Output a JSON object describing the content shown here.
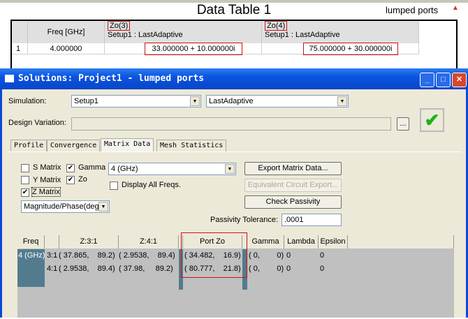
{
  "report": {
    "title": "Data Table 1",
    "subtitle": "lumped ports",
    "headers": [
      "Freq [GHz]",
      "Zo(3)",
      "Zo(4)"
    ],
    "sub_header": "Setup1 : LastAdaptive",
    "rows": [
      {
        "index": "1",
        "freq": "4.000000",
        "zo3": "33.000000 + 10.000000i",
        "zo4": "75.000000 + 30.000000i"
      }
    ]
  },
  "dialog": {
    "title": "Solutions: Project1 - lumped ports",
    "simulation_label": "Simulation:",
    "setup": "Setup1",
    "pass": "LastAdaptive",
    "design_variation_label": "Design Variation:",
    "design_variation": "",
    "browse": "...",
    "tabs": [
      "Profile",
      "Convergence",
      "Matrix Data",
      "Mesh Statistics"
    ],
    "active_tab": "Matrix Data",
    "checkboxes": {
      "s_matrix": "S Matrix",
      "gamma": "Gamma",
      "y_matrix": "Y Matrix",
      "zo": "Zo",
      "z_matrix": "Z Matrix",
      "display_all": "Display All Freqs."
    },
    "format": "Magnitude/Phase(deg",
    "freq": "4 (GHz)",
    "buttons": {
      "export": "Export Matrix Data...",
      "equiv": "Equivalent Circuit Export...",
      "passivity": "Check Passivity"
    },
    "tolerance_label": "Passivity Tolerance:",
    "tolerance": ".0001",
    "grid": {
      "headers": [
        "Freq",
        "",
        "Z:3:1",
        "Z:4:1",
        "Port Zo",
        "Gamma",
        "Lambda",
        "Epsilon"
      ],
      "freq": "4 (GHz)",
      "rows": [
        {
          "label": "3:1",
          "z31": "( 37.865,    89.2)",
          "z41": "( 2.9538,    89.4)",
          "portzo": "( 34.482,    16.9)",
          "gamma": "( 0,        0)",
          "lambda": "0",
          "epsilon": "0"
        },
        {
          "label": "4:1",
          "z31": "( 2.9538,    89.4)",
          "z41": "( 37.98,     89.2)",
          "portzo": "( 80.777,    21.8)",
          "gamma": "( 0,        0)",
          "lambda": "0",
          "epsilon": "0"
        }
      ]
    }
  }
}
